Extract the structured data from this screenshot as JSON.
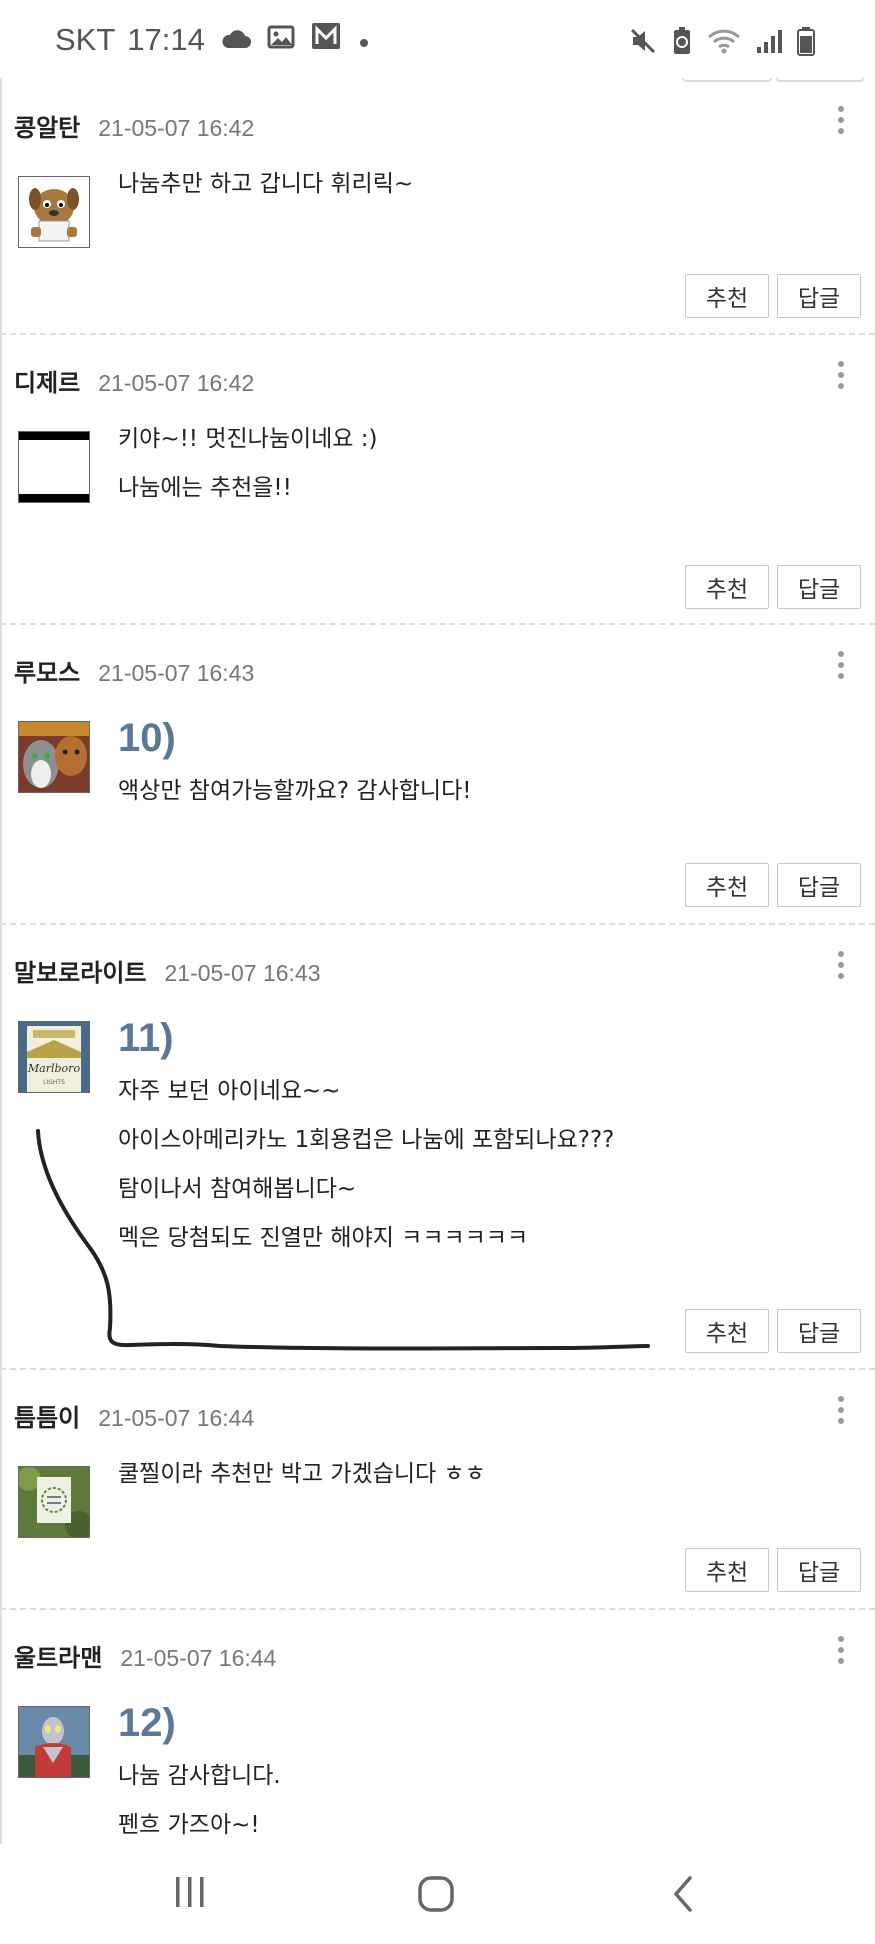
{
  "status_bar": {
    "carrier": "SKT",
    "time": "17:14",
    "left_icons": [
      "cloud-icon",
      "image-icon",
      "gmail-icon",
      "dot-icon"
    ],
    "right_icons": [
      "mute-icon",
      "battery-saver-icon",
      "wifi-icon",
      "signal-icon",
      "battery-icon"
    ]
  },
  "buttons": {
    "recommend": "추천",
    "reply": "답글"
  },
  "comments": [
    {
      "author": "콩알탄",
      "date": "21-05-07 16:42",
      "avatar": "dog-cartoon-avatar",
      "number": "",
      "lines": [
        "나눔추만 하고 갑니다  휘리릭~"
      ]
    },
    {
      "author": "디제르",
      "date": "21-05-07 16:42",
      "avatar": "black-white-frame-avatar",
      "number": "",
      "lines": [
        "키야~!! 멋진나눔이네요 :)",
        "나눔에는 추천을!!"
      ]
    },
    {
      "author": "루모스",
      "date": "21-05-07 16:43",
      "avatar": "two-cats-avatar",
      "number": "10)",
      "lines": [
        "액상만 참여가능할까요? 감사합니다!"
      ]
    },
    {
      "author": "말보로라이트",
      "date": "21-05-07 16:43",
      "avatar": "marlboro-pack-avatar",
      "number": "11)",
      "lines": [
        "자주 보던 아이네요~~",
        "아이스아메리카노 1회용컵은 나눔에 포함되나요???",
        "탐이나서 참여해봅니다~",
        "멕은 당첨되도 진열만 해야지 ㅋㅋㅋㅋㅋㅋ"
      ]
    },
    {
      "author": "틈틈이",
      "date": "21-05-07 16:44",
      "avatar": "green-sign-avatar",
      "number": "",
      "lines": [
        "쿨찔이라 추천만 박고 가겠습니다 ㅎㅎ"
      ]
    },
    {
      "author": "울트라맨",
      "date": "21-05-07 16:44",
      "avatar": "ultraman-avatar",
      "number": "12)",
      "lines": [
        "나눔 감사합니다.",
        "펜흐 가즈아~!"
      ]
    }
  ],
  "nav_bar": [
    "recent-apps-icon",
    "home-icon",
    "back-icon"
  ],
  "colors": {
    "number_blue": "#5b7896",
    "divider": "#dddddd",
    "text": "#222222",
    "date": "#777777"
  }
}
